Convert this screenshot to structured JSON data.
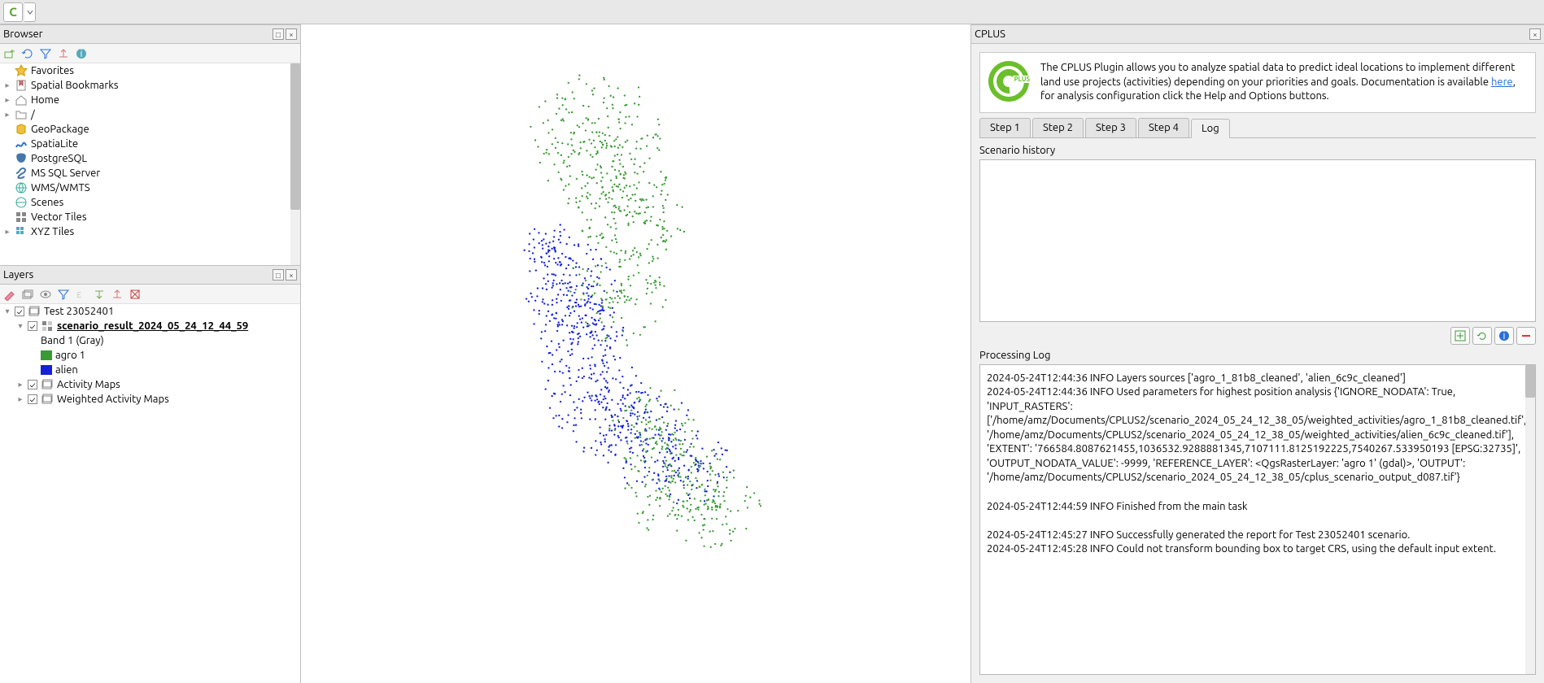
{
  "toolbar": {
    "cplus_button": "C"
  },
  "browser": {
    "title": "Browser",
    "icons": [
      "new-layer",
      "refresh",
      "filter",
      "collapse",
      "info"
    ],
    "items": [
      {
        "exp": "",
        "icon": "star",
        "label": "Favorites"
      },
      {
        "exp": "▸",
        "icon": "bookmark",
        "label": "Spatial Bookmarks"
      },
      {
        "exp": "▸",
        "icon": "home",
        "label": "Home"
      },
      {
        "exp": "▸",
        "icon": "folder",
        "label": "/"
      },
      {
        "exp": "",
        "icon": "geopackage",
        "label": "GeoPackage"
      },
      {
        "exp": "",
        "icon": "spatialite",
        "label": "SpatiaLite"
      },
      {
        "exp": "",
        "icon": "postgres",
        "label": "PostgreSQL"
      },
      {
        "exp": "",
        "icon": "mssql",
        "label": "MS SQL Server"
      },
      {
        "exp": "",
        "icon": "wms",
        "label": "WMS/WMTS"
      },
      {
        "exp": "",
        "icon": "scenes",
        "label": "Scenes"
      },
      {
        "exp": "",
        "icon": "vectortiles",
        "label": "Vector Tiles"
      },
      {
        "exp": "▸",
        "icon": "xyz",
        "label": "XYZ Tiles"
      }
    ]
  },
  "layers": {
    "title": "Layers",
    "group_name": "Test 23052401",
    "result_layer": "scenario_result_2024_05_24_12_44_59",
    "band_label": "Band 1 (Gray)",
    "legend": [
      {
        "color": "#3a9a33",
        "label": "agro 1"
      },
      {
        "color": "#1421d6",
        "label": "alien"
      }
    ],
    "groups": [
      {
        "label": "Activity Maps"
      },
      {
        "label": "Weighted Activity Maps"
      }
    ]
  },
  "cplus": {
    "title": "CPLUS",
    "logo_text": "PLUS",
    "desc_1": "The CPLUS Plugin allows you to analyze spatial data to predict ideal locations to implement different land use projects (activities) depending on your priorities and goals. Documentation is available ",
    "here": "here",
    "desc_2": ", for analysis configuration click the Help and Options buttons.",
    "tabs": [
      "Step 1",
      "Step 2",
      "Step 3",
      "Step 4",
      "Log"
    ],
    "active_tab": "Log",
    "scenario_history_label": "Scenario history",
    "processing_log_label": "Processing Log",
    "log_lines": [
      "2024-05-24T12:44:36 INFO Layers sources ['agro_1_81b8_cleaned', 'alien_6c9c_cleaned']",
      "2024-05-24T12:44:36 INFO Used parameters for highest position analysis {'IGNORE_NODATA': True, 'INPUT_RASTERS': ['/home/amz/Documents/CPLUS2/scenario_2024_05_24_12_38_05/weighted_activities/agro_1_81b8_cleaned.tif', '/home/amz/Documents/CPLUS2/scenario_2024_05_24_12_38_05/weighted_activities/alien_6c9c_cleaned.tif'], 'EXTENT': '766584.8087621455,1036532.9288881345,7107111.8125192225,7540267.533950193 [EPSG:32735]', 'OUTPUT_NODATA_VALUE': -9999, 'REFERENCE_LAYER': <QgsRasterLayer: 'agro 1' (gdal)>, 'OUTPUT': '/home/amz/Documents/CPLUS2/scenario_2024_05_24_12_38_05/cplus_scenario_output_d087.tif'}",
      "",
      "2024-05-24T12:44:59 INFO Finished from the main task",
      "",
      "2024-05-24T12:45:27 INFO Successfully generated the report for Test 23052401 scenario.",
      "2024-05-24T12:45:28 INFO Could not transform bounding box to target CRS, using the default input extent."
    ]
  }
}
